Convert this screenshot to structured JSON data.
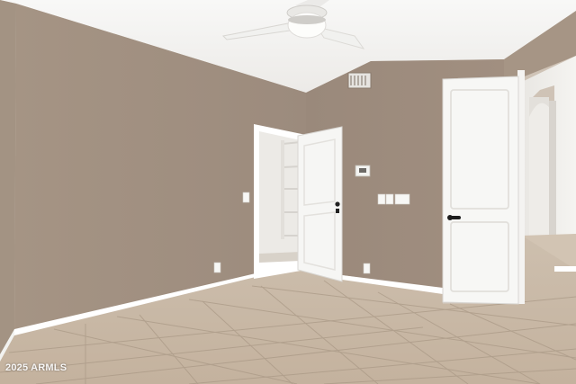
{
  "photo": {
    "watermark": "2025 ARMLS",
    "colors": {
      "wall": "#9f8e80",
      "wall_left": "#a08f81",
      "ceiling": "#f4f4f2",
      "floor": "#c9b9a7",
      "grout": "#a89886",
      "trim": "#ffffff",
      "door": "#f7f7f5"
    }
  }
}
